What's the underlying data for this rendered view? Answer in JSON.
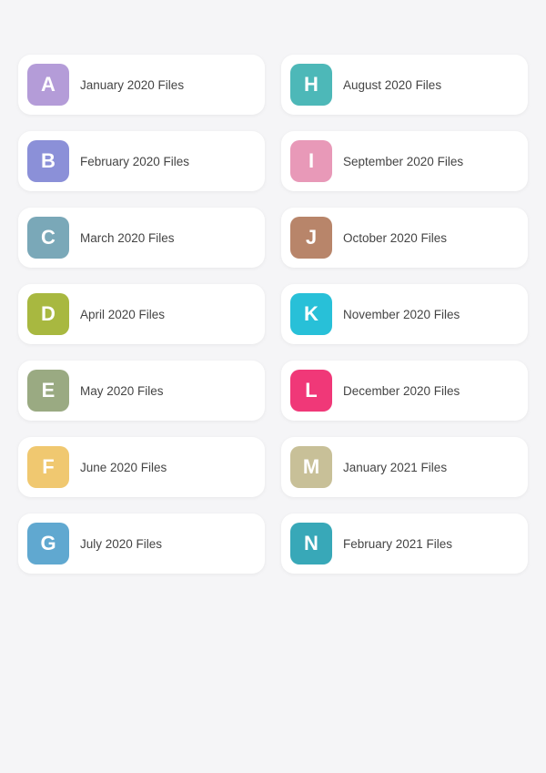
{
  "folders": [
    {
      "letter": "A",
      "label": "January 2020 Files",
      "color": "#b49cd8"
    },
    {
      "letter": "H",
      "label": "August 2020 Files",
      "color": "#4db8b8"
    },
    {
      "letter": "B",
      "label": "February 2020 Files",
      "color": "#8b90d8"
    },
    {
      "letter": "I",
      "label": "September 2020 Files",
      "color": "#e899b8"
    },
    {
      "letter": "C",
      "label": "March 2020 Files",
      "color": "#7aa8b8"
    },
    {
      "letter": "J",
      "label": "October 2020 Files",
      "color": "#b8856a"
    },
    {
      "letter": "D",
      "label": "April 2020 Files",
      "color": "#a8b840"
    },
    {
      "letter": "K",
      "label": "November 2020 Files",
      "color": "#28c0d8"
    },
    {
      "letter": "E",
      "label": "May 2020 Files",
      "color": "#9aaa82"
    },
    {
      "letter": "L",
      "label": "December 2020 Files",
      "color": "#f03878"
    },
    {
      "letter": "F",
      "label": "June 2020 Files",
      "color": "#f0c870"
    },
    {
      "letter": "M",
      "label": "January 2021 Files",
      "color": "#c8c098"
    },
    {
      "letter": "G",
      "label": "July 2020 Files",
      "color": "#60a8d0"
    },
    {
      "letter": "N",
      "label": "February 2021 Files",
      "color": "#38a8b8"
    }
  ]
}
